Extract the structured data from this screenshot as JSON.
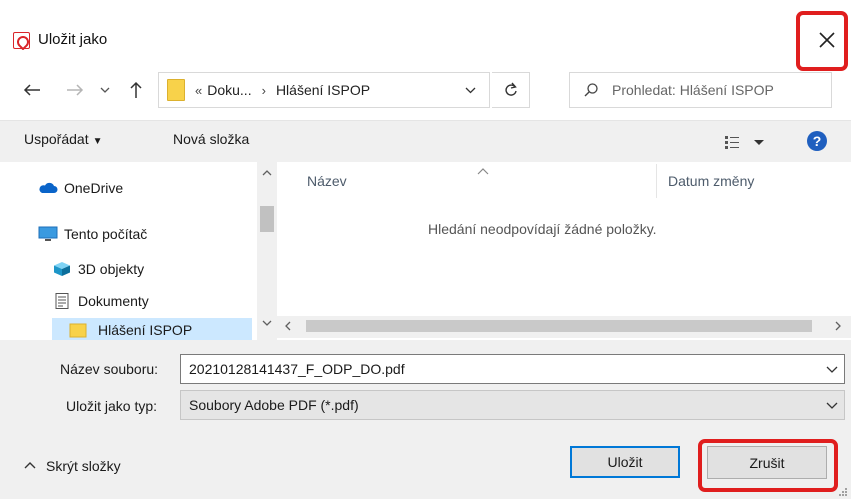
{
  "window": {
    "title": "Uložit jako",
    "app_icon": "adobe-pdf-icon",
    "close_icon": "close-icon",
    "highlight_color": "#e01e1e"
  },
  "navigation": {
    "back_icon": "arrow-left-icon",
    "forward_icon": "arrow-right-icon",
    "recent_icon": "chevron-down-icon",
    "up_icon": "arrow-up-icon",
    "address": {
      "overflow": "«",
      "crumbs": [
        "Doku...",
        "Hlášení ISPOP"
      ],
      "separator": "›"
    },
    "refresh_icon": "refresh-icon",
    "search_placeholder": "Prohledat: Hlášení ISPOP"
  },
  "toolbar": {
    "organize_label": "Uspořádat",
    "new_folder_label": "Nová složka",
    "view_icon": "view-options-icon",
    "help_label": "?"
  },
  "nav_pane": {
    "items": [
      {
        "label": "OneDrive",
        "icon": "cloud-icon"
      },
      {
        "label": "Tento počítač",
        "icon": "computer-icon"
      },
      {
        "label": "3D objekty",
        "icon": "cube-3d-icon"
      },
      {
        "label": "Dokumenty",
        "icon": "document-icon"
      },
      {
        "label": "Hlášení ISPOP",
        "icon": "folder-icon",
        "selected": true
      }
    ]
  },
  "file_list": {
    "columns": [
      "Název",
      "Datum změny"
    ],
    "empty_message": "Hledání neodpovídají žádné položky."
  },
  "form": {
    "filename_label": "Název souboru:",
    "filename_value": "20210128141437_F_ODP_DO.pdf",
    "filetype_label": "Uložit jako typ:",
    "filetype_value": "Soubory Adobe PDF (*.pdf)"
  },
  "footer": {
    "hide_folders_label": "Skrýt složky",
    "save_label": "Uložit",
    "cancel_label": "Zrušit"
  }
}
